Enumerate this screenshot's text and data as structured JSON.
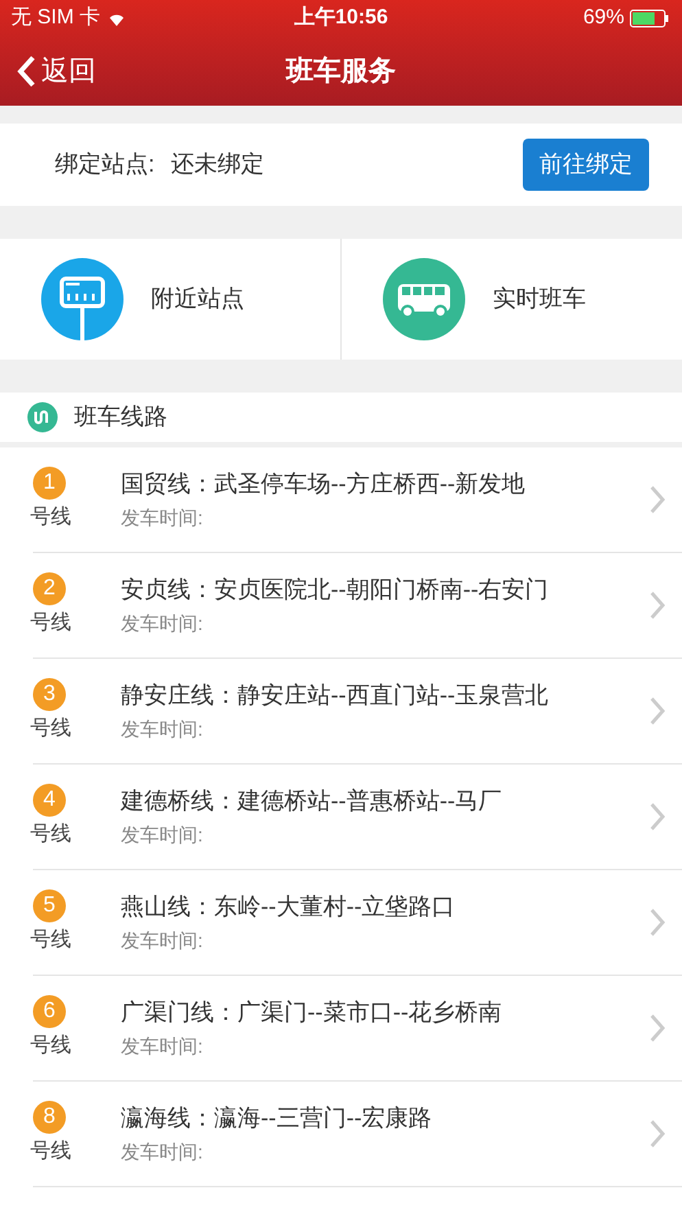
{
  "status_bar": {
    "carrier": "无 SIM 卡",
    "time": "上午10:56",
    "battery": "69%"
  },
  "nav": {
    "back": "返回",
    "title": "班车服务"
  },
  "binding": {
    "label": "绑定站点:",
    "value": "还未绑定",
    "button": "前往绑定"
  },
  "tiles": [
    {
      "kind": "station",
      "label": "附近站点",
      "color": "#1aa6e8"
    },
    {
      "kind": "bus",
      "label": "实时班车",
      "color": "#35b893"
    }
  ],
  "section": {
    "title": "班车线路"
  },
  "routes": [
    {
      "number": "1",
      "suffix": "号线",
      "name": "国贸线：武圣停车场--方庄桥西--新发地",
      "time_label": "发车时间:"
    },
    {
      "number": "2",
      "suffix": "号线",
      "name": "安贞线：安贞医院北--朝阳门桥南--右安门",
      "time_label": "发车时间:"
    },
    {
      "number": "3",
      "suffix": "号线",
      "name": "静安庄线：静安庄站--西直门站--玉泉营北",
      "time_label": "发车时间:"
    },
    {
      "number": "4",
      "suffix": "号线",
      "name": "建德桥线：建德桥站--普惠桥站--马厂",
      "time_label": "发车时间:"
    },
    {
      "number": "5",
      "suffix": "号线",
      "name": "燕山线：东岭--大董村--立垡路口",
      "time_label": "发车时间:"
    },
    {
      "number": "6",
      "suffix": "号线",
      "name": "广渠门线：广渠门--菜市口--花乡桥南",
      "time_label": "发车时间:"
    },
    {
      "number": "8",
      "suffix": "号线",
      "name": "瀛海线：瀛海--三营门--宏康路",
      "time_label": "发车时间:"
    }
  ]
}
